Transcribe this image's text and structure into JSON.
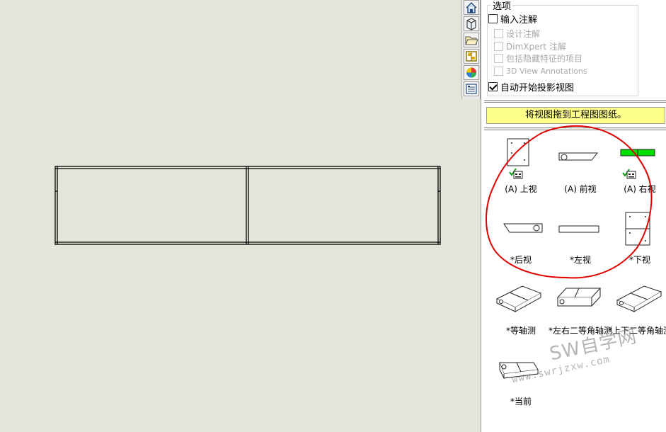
{
  "options_group": {
    "title": "选项",
    "import_annotations": "输入注解",
    "design_annotations": "设计注解",
    "dimxpert_annotations": "DimXpert 注解",
    "include_hidden": "包括隐藏特征的项目",
    "view_annotations_3d": "3D View Annotations",
    "auto_start_projection": "自动开始投影视图"
  },
  "hint": "将视图拖到工程图图纸。",
  "views": [
    {
      "label": "(A) 上视"
    },
    {
      "label": "(A) 前视"
    },
    {
      "label": "(A) 右视"
    },
    {
      "label": "*后视"
    },
    {
      "label": "*左视"
    },
    {
      "label": "*下视"
    },
    {
      "label": "*等轴测"
    },
    {
      "label": "*左右二等角轴测"
    },
    {
      "label": "*上下二等角轴测"
    },
    {
      "label": "*当前"
    }
  ],
  "watermark": {
    "line1": "SW自学网",
    "line2": "www.swrjzxw.com"
  },
  "colors": {
    "hint_bg": "#ffff8c",
    "accent_green": "#00e000",
    "annotation_red": "#e00000",
    "canvas_bg": "#e5e4d9"
  }
}
